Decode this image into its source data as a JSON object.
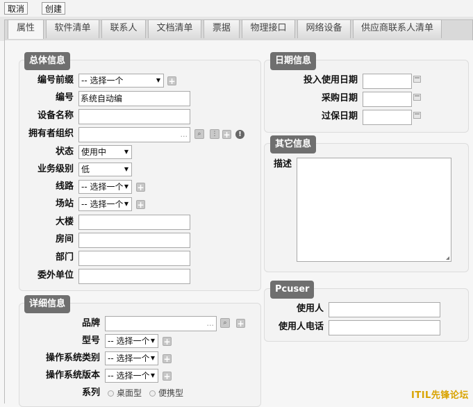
{
  "toolbar": {
    "cancel": "取消",
    "create": "创建"
  },
  "tabs": [
    "属性",
    "软件清单",
    "联系人",
    "文档清单",
    "票据",
    "物理接口",
    "网络设备",
    "供应商联系人清单"
  ],
  "general": {
    "title": "总体信息",
    "prefix": {
      "label": "编号前缀",
      "value": "-- 选择一个"
    },
    "number": {
      "label": "编号",
      "value": "系统自动编"
    },
    "device_name": {
      "label": "设备名称",
      "value": ""
    },
    "owner_org": {
      "label": "拥有者组织",
      "value": "",
      "ellipsis": "..."
    },
    "status": {
      "label": "状态",
      "value": "使用中"
    },
    "biz_level": {
      "label": "业务级别",
      "value": "低"
    },
    "line": {
      "label": "线路",
      "value": "-- 选择一个"
    },
    "site": {
      "label": "场站",
      "value": "-- 选择一个"
    },
    "building": {
      "label": "大楼",
      "value": ""
    },
    "room": {
      "label": "房间",
      "value": ""
    },
    "dept": {
      "label": "部门",
      "value": ""
    },
    "outsource": {
      "label": "委外单位",
      "value": ""
    }
  },
  "detail": {
    "title": "详细信息",
    "brand": {
      "label": "品牌",
      "value": "",
      "ellipsis": "..."
    },
    "model": {
      "label": "型号",
      "value": "-- 选择一个"
    },
    "os_type": {
      "label": "操作系统类别",
      "value": "-- 选择一个"
    },
    "os_version": {
      "label": "操作系统版本",
      "value": "-- 选择一个"
    },
    "series": {
      "label": "系列",
      "options": [
        "桌面型",
        "便携型"
      ]
    }
  },
  "dates": {
    "title": "日期信息",
    "in_use": {
      "label": "投入使用日期",
      "value": ""
    },
    "purchase": {
      "label": "采购日期",
      "value": ""
    },
    "warranty": {
      "label": "过保日期",
      "value": ""
    }
  },
  "other": {
    "title": "其它信息",
    "desc_label": "描述",
    "desc_value": ""
  },
  "pcuser": {
    "title": "Pcuser",
    "user": {
      "label": "使用人",
      "value": ""
    },
    "phone": {
      "label": "使用人电话",
      "value": ""
    }
  },
  "watermark": "ITIL先锋论坛",
  "icons": {
    "plus": "+",
    "search": "search-icon",
    "warning": "!",
    "dropdown": "▾"
  }
}
